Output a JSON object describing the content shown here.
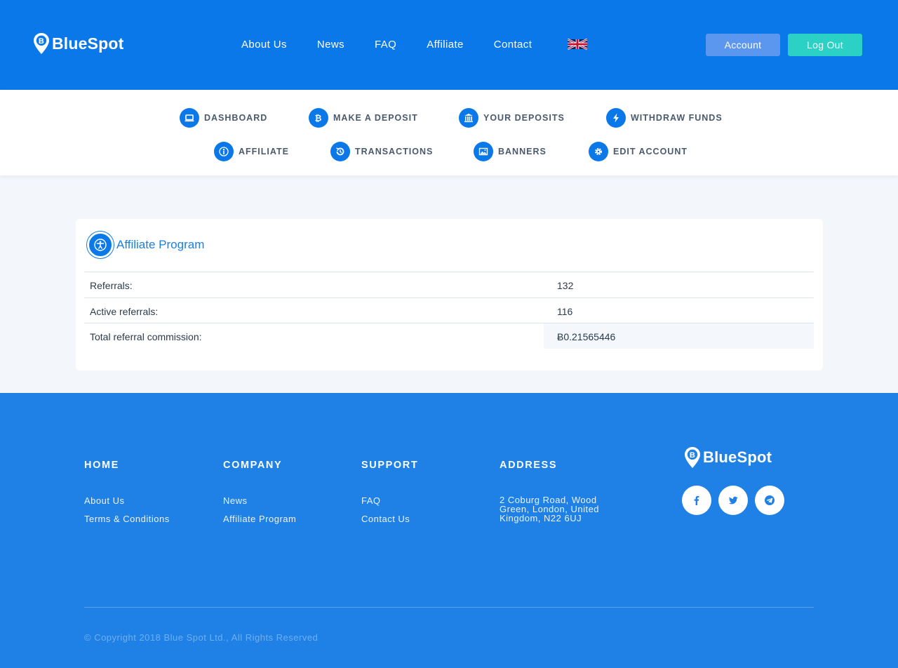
{
  "header": {
    "logo_text": "BlueSpot",
    "nav": [
      "About Us",
      "News",
      "FAQ",
      "Affiliate",
      "Contact"
    ],
    "language_icon": "uk-flag-icon",
    "account_label": "Account",
    "logout_label": "Log Out"
  },
  "subnav": {
    "row1": [
      {
        "label": "DASHBOARD",
        "icon": "laptop-icon"
      },
      {
        "label": "MAKE A DEPOSIT",
        "icon": "bitcoin-icon"
      },
      {
        "label": "YOUR DEPOSITS",
        "icon": "bank-icon"
      },
      {
        "label": "WITHDRAW FUNDS",
        "icon": "lightning-icon"
      }
    ],
    "row2": [
      {
        "label": "AFFILIATE",
        "icon": "person-icon"
      },
      {
        "label": "TRANSACTIONS",
        "icon": "history-icon"
      },
      {
        "label": "BANNERS",
        "icon": "image-icon"
      },
      {
        "label": "EDIT ACCOUNT",
        "icon": "gear-icon"
      }
    ]
  },
  "affiliate": {
    "title": "Affiliate Program",
    "rows": [
      {
        "label": "Referrals:",
        "value": "132"
      },
      {
        "label": "Active referrals:",
        "value": "116"
      },
      {
        "label": "Total referral commission:",
        "value": "Ƀ0.21565446"
      }
    ]
  },
  "footer": {
    "columns": [
      {
        "heading": "HOME",
        "links": [
          "About Us",
          "Terms & Conditions"
        ]
      },
      {
        "heading": "COMPANY",
        "links": [
          "News",
          "Affiliate Program"
        ]
      },
      {
        "heading": "SUPPORT",
        "links": [
          "FAQ",
          "Contact Us"
        ]
      }
    ],
    "address_heading": "ADDRESS",
    "address": "2 Coburg Road, Wood Green, London, United Kingdom, N22 6UJ",
    "logo_text": "BlueSpot",
    "socials": [
      "facebook-icon",
      "twitter-icon",
      "telegram-icon"
    ],
    "copyright": "© Copyright 2018 Blue Spot Ltd., All Rights Reserved"
  },
  "colors": {
    "header_bg": "#0a78e8",
    "footer_bg": "#1f80e6",
    "account_button": "#5b97ef",
    "logout_button": "#2bd1c4",
    "title_blue": "#1c7fe0"
  }
}
